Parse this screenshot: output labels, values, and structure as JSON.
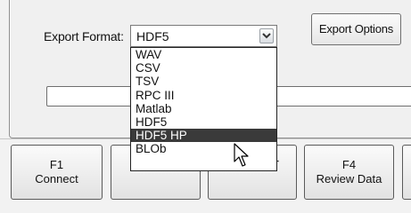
{
  "export": {
    "label": "Export Format:",
    "selected_value": "HDF5",
    "options_button_label": "Export Options",
    "dropdown_options": [
      "WAV",
      "CSV",
      "TSV",
      "RPC III",
      "Matlab",
      "HDF5",
      "HDF5 HP",
      "BLOb"
    ],
    "highlighted_option": "HDF5 HP"
  },
  "function_keys": [
    {
      "key": "F1",
      "label": "Connect"
    },
    {
      "key": "",
      "label": ""
    },
    {
      "key": "",
      "label": "Show FFT"
    },
    {
      "key": "F4",
      "label": "Review Data"
    },
    {
      "key": "",
      "label": ""
    }
  ],
  "icons": [
    "chevron-down-icon",
    "mouse-pointer-icon"
  ],
  "colors": {
    "highlight": "#3a3a3a",
    "background": "#f0f0f0"
  }
}
